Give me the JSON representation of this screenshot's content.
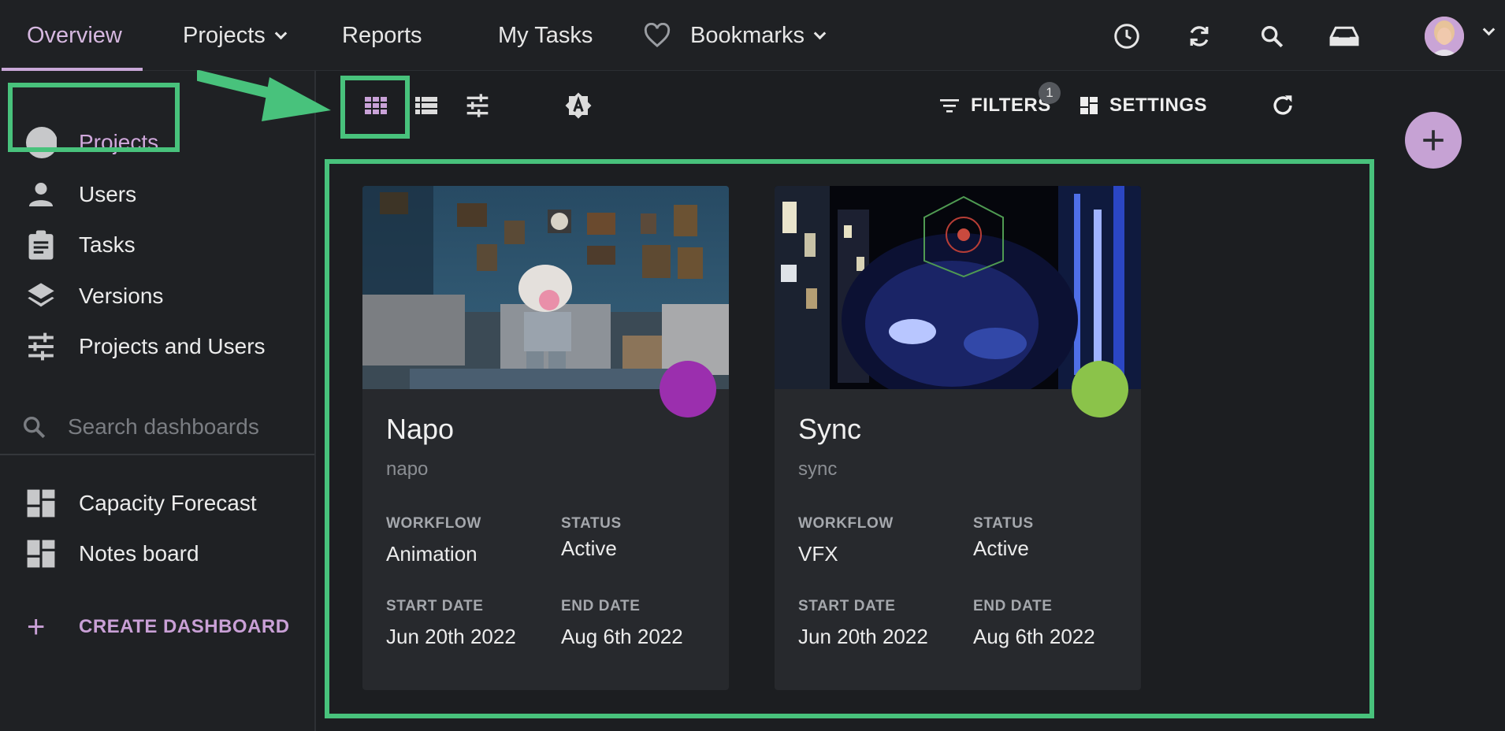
{
  "topnav": {
    "overview": "Overview",
    "projects": "Projects",
    "reports": "Reports",
    "my_tasks": "My Tasks",
    "bookmarks": "Bookmarks",
    "icons": [
      "history-icon",
      "sync-icon",
      "search-icon",
      "inbox-icon"
    ],
    "avatar": "user-avatar"
  },
  "sidebar": {
    "items": [
      {
        "label": "Projects",
        "icon": "circle-icon"
      },
      {
        "label": "Users",
        "icon": "person-icon"
      },
      {
        "label": "Tasks",
        "icon": "clipboard-icon"
      },
      {
        "label": "Versions",
        "icon": "layers-icon"
      },
      {
        "label": "Projects and Users",
        "icon": "tune-icon"
      }
    ],
    "search_placeholder": "Search dashboards",
    "dashboards": [
      {
        "label": "Capacity Forecast",
        "icon": "dashboard-icon"
      },
      {
        "label": "Notes board",
        "icon": "dashboard-icon"
      }
    ],
    "create_label": "CREATE DASHBOARD"
  },
  "toolbar": {
    "filters_label": "FILTERS",
    "filters_count": "1",
    "settings_label": "SETTINGS"
  },
  "accent": "#48c27c",
  "projects": [
    {
      "name": "Napo",
      "code": "napo",
      "color": "#9b2fae",
      "workflow_label": "WORKFLOW",
      "workflow": "Animation",
      "status_label": "STATUS",
      "status": "Active",
      "start_label": "START DATE",
      "start": "Jun 20th 2022",
      "end_label": "END DATE",
      "end": "Aug 6th 2022"
    },
    {
      "name": "Sync",
      "code": "sync",
      "color": "#8bc34a",
      "workflow_label": "WORKFLOW",
      "workflow": "VFX",
      "status_label": "STATUS",
      "status": "Active",
      "start_label": "START DATE",
      "start": "Jun 20th 2022",
      "end_label": "END DATE",
      "end": "Aug 6th 2022"
    }
  ]
}
